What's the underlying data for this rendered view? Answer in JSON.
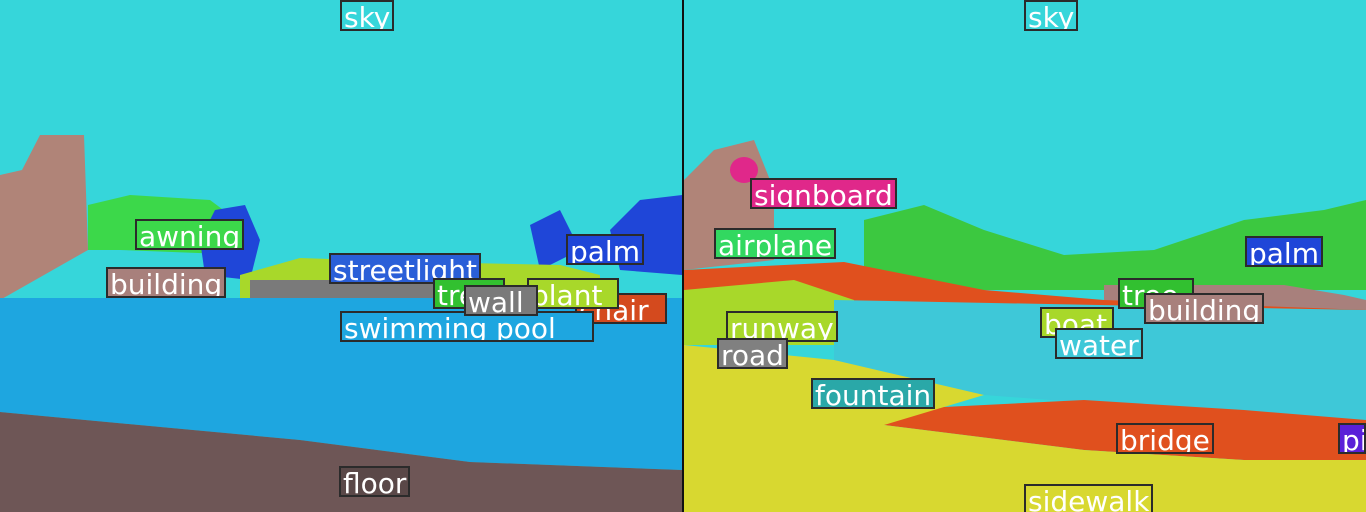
{
  "left_panel": {
    "labels": [
      {
        "id": "sky",
        "text": "sky",
        "color": "#2fe0e0"
      },
      {
        "id": "awning",
        "text": "awning",
        "color": "#3cd84a"
      },
      {
        "id": "building",
        "text": "building",
        "color": "#a8807c"
      },
      {
        "id": "streetlight",
        "text": "streetlight",
        "color": "#2a5fd8"
      },
      {
        "id": "palm",
        "text": "palm",
        "color": "#1f46d8"
      },
      {
        "id": "tree",
        "text": "tree",
        "color": "#32c030"
      },
      {
        "id": "wall",
        "text": "wall",
        "color": "#7a7a7a"
      },
      {
        "id": "plant",
        "text": "plant",
        "color": "#a8d82a"
      },
      {
        "id": "chair",
        "text": "chair",
        "color": "#d44a1e"
      },
      {
        "id": "swimming-pool",
        "text": "swimming pool",
        "color": "#1ea6e0"
      },
      {
        "id": "floor",
        "text": "floor",
        "color": "#5a4848"
      }
    ]
  },
  "right_panel": {
    "labels": [
      {
        "id": "sky",
        "text": "sky",
        "color": "#2fe0e0"
      },
      {
        "id": "signboard",
        "text": "signboard",
        "color": "#e0288a"
      },
      {
        "id": "airplane",
        "text": "airplane",
        "color": "#32d860"
      },
      {
        "id": "palm",
        "text": "palm",
        "color": "#1f46d8"
      },
      {
        "id": "tree",
        "text": "tree",
        "color": "#32c030"
      },
      {
        "id": "building",
        "text": "building",
        "color": "#a8807c"
      },
      {
        "id": "runway",
        "text": "runway",
        "color": "#a8d82a"
      },
      {
        "id": "boat",
        "text": "boat",
        "color": "#a8d82a"
      },
      {
        "id": "road",
        "text": "road",
        "color": "#808080"
      },
      {
        "id": "water",
        "text": "water",
        "color": "#3ec8d8"
      },
      {
        "id": "fountain",
        "text": "fountain",
        "color": "#2aa8a8"
      },
      {
        "id": "bridge",
        "text": "bridge",
        "color": "#e0501e"
      },
      {
        "id": "pier",
        "text": "pi",
        "color": "#5a20d8"
      },
      {
        "id": "sidewalk",
        "text": "sidewalk",
        "color": "#d8d830"
      }
    ]
  }
}
